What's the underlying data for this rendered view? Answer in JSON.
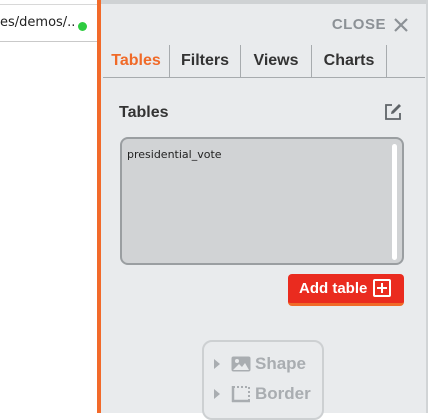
{
  "left_tab": {
    "title": "es/demos/..."
  },
  "close": {
    "label": "CLOSE"
  },
  "tabs": [
    {
      "label": "Tables",
      "active": true
    },
    {
      "label": "Filters",
      "active": false
    },
    {
      "label": "Views",
      "active": false
    },
    {
      "label": "Charts",
      "active": false
    }
  ],
  "tables_section": {
    "title": "Tables",
    "items": [
      "presidential_vote"
    ],
    "add_button": "Add table"
  },
  "format_options": [
    {
      "label": "Shape",
      "icon": "image-icon"
    },
    {
      "label": "Border",
      "icon": "border-icon"
    }
  ],
  "colors": {
    "accent": "#f06a28",
    "button": "#ea2b1f",
    "status": "#2ecc40"
  }
}
